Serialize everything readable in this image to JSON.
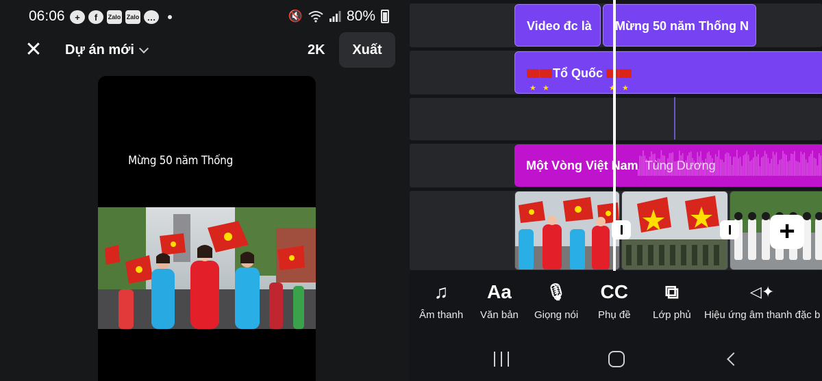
{
  "status_bar": {
    "time": "06:06",
    "icons": [
      "person-add-icon",
      "facebook-icon",
      "zalo-icon",
      "zalo-icon",
      "messenger-icon",
      "dot-icon"
    ],
    "zalo_label": "Zalo",
    "battery_percent": "80%"
  },
  "header": {
    "project_name": "Dự án mới",
    "resolution": "2K",
    "export_label": "Xuất"
  },
  "preview": {
    "caption": "Mừng 50 năm Thống"
  },
  "timeline": {
    "text_clips": [
      "Video đc là",
      "Mừng 50 năm Thống N"
    ],
    "sticker_clip": {
      "left_flags": 2,
      "label": "Tổ Quốc",
      "right_flags": 2
    },
    "music_clip": {
      "title": "Một Vòng Việt Nam",
      "artist": "Tùng Dương"
    },
    "add_clip_icon": "plus-icon"
  },
  "toolbar": [
    {
      "icon": "music-note-icon",
      "glyph": "♫",
      "label": "Âm thanh"
    },
    {
      "icon": "text-icon",
      "glyph": "Aa",
      "label": "Văn bản"
    },
    {
      "icon": "microphone-icon",
      "glyph": "🎙",
      "label": "Giọng nói"
    },
    {
      "icon": "captions-icon",
      "glyph": "CC",
      "label": "Phụ đề"
    },
    {
      "icon": "overlay-icon",
      "glyph": "⧉",
      "label": "Lớp phủ"
    },
    {
      "icon": "sound-effects-icon",
      "glyph": "◁✦",
      "label": "Hiệu ứng âm thanh đặc b"
    }
  ],
  "colors": {
    "text_clip": "#7742f1",
    "music_clip": "#c013ce",
    "background": "#17181a",
    "track": "#26272b"
  }
}
